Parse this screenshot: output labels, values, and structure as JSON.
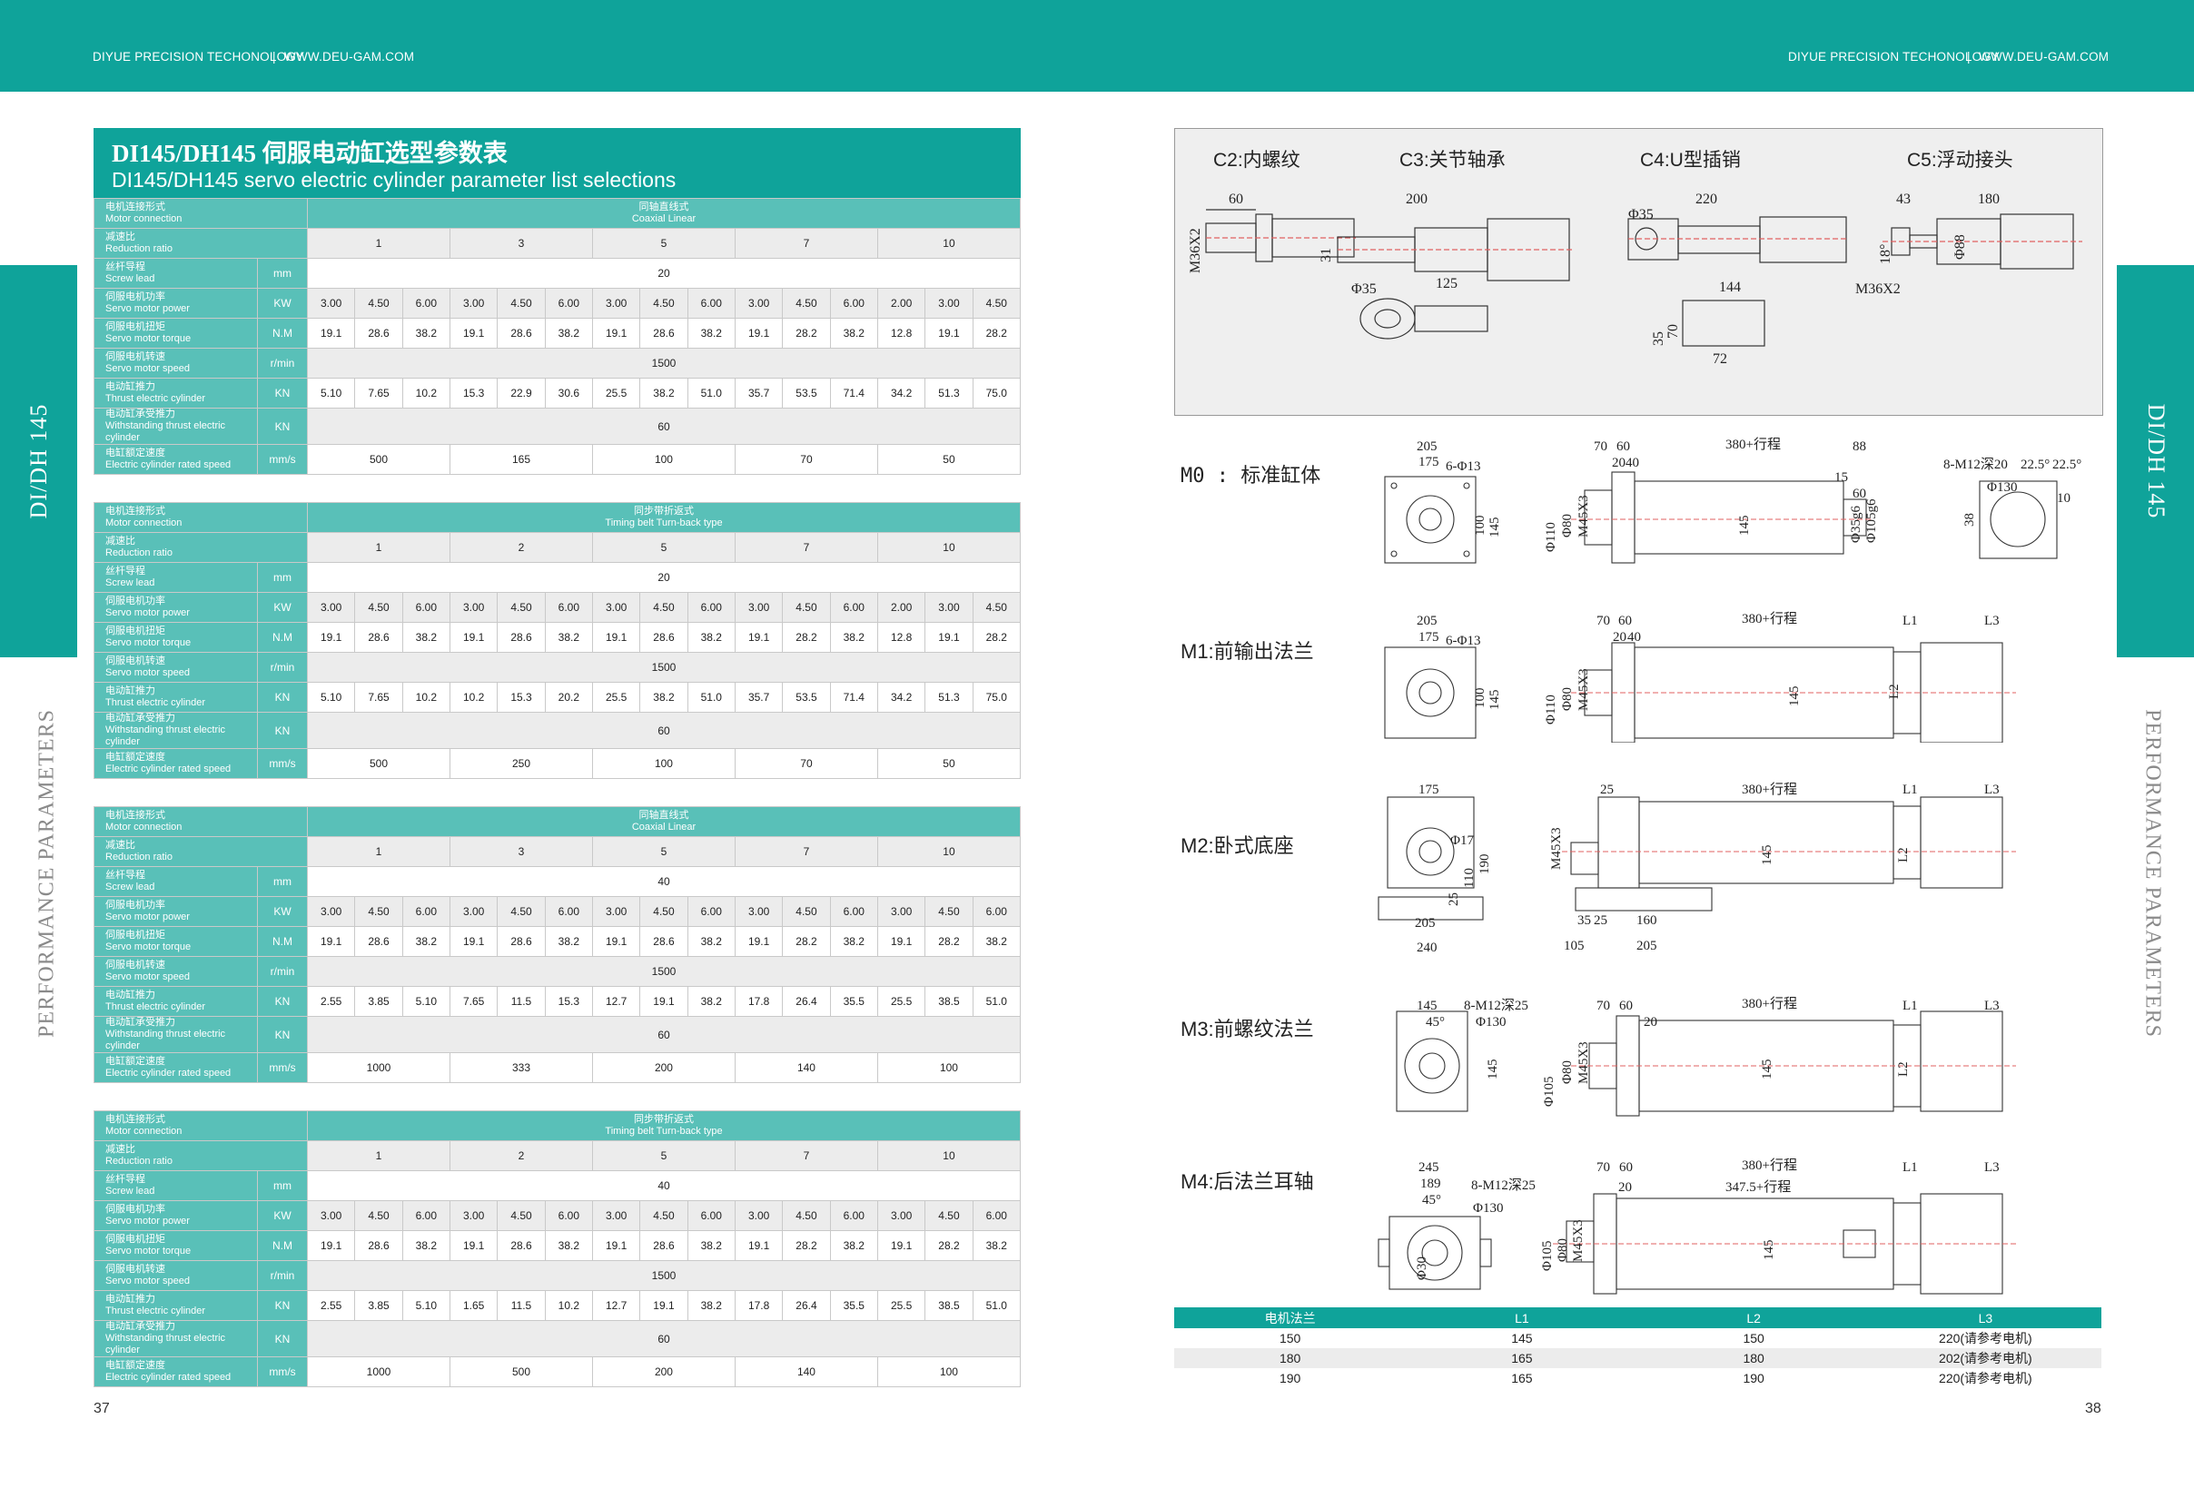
{
  "header": {
    "brand": "DIYUE PRECISION TECHONOLOGY",
    "sep": "|",
    "website": "WWW.DEU-GAM.COM"
  },
  "side": {
    "model": "DI/DH 145",
    "section": "PERFORMANCE PARAMETERS"
  },
  "title": {
    "cn": "DI145/DH145 伺服电动缸选型参数表",
    "en": "DI145/DH145 servo electric cylinder parameter list selections"
  },
  "labels": {
    "motor_cn": "电机连接形式",
    "motor_en": "Motor connection",
    "ratio_cn": "减速比",
    "ratio_en": "Reduction ratio",
    "lead_cn": "丝杆导程",
    "lead_en": "Screw lead",
    "power_cn": "伺服电机功率",
    "power_en": "Servo motor power",
    "torque_cn": "伺服电机扭矩",
    "torque_en": "Servo motor torque",
    "speed_cn": "伺服电机转速",
    "speed_en": "Servo motor speed",
    "thrust_cn": "电动缸推力",
    "thrust_en": "Thrust electric cylinder",
    "withstand_cn": "电动缸承受推力",
    "withstand_en": "Withstanding thrust electric cylinder",
    "rated_cn": "电缸额定速度",
    "rated_en": "Electric cylinder rated speed"
  },
  "units": {
    "lead": "mm",
    "power": "KW",
    "torque": "N.M",
    "speed": "r/min",
    "thrust": "KN",
    "withstand": "KN",
    "rated": "mm/s"
  },
  "tables": [
    {
      "type_cn": "同轴直线式",
      "type_en": "Coaxial Linear",
      "ratios": [
        "1",
        "3",
        "5",
        "7",
        "10"
      ],
      "lead": "20",
      "power": [
        "3.00",
        "4.50",
        "6.00",
        "3.00",
        "4.50",
        "6.00",
        "3.00",
        "4.50",
        "6.00",
        "3.00",
        "4.50",
        "6.00",
        "2.00",
        "3.00",
        "4.50"
      ],
      "torque": [
        "19.1",
        "28.6",
        "38.2",
        "19.1",
        "28.6",
        "38.2",
        "19.1",
        "28.6",
        "38.2",
        "19.1",
        "28.2",
        "38.2",
        "12.8",
        "19.1",
        "28.2"
      ],
      "speed": "1500",
      "thrust": [
        "5.10",
        "7.65",
        "10.2",
        "15.3",
        "22.9",
        "30.6",
        "25.5",
        "38.2",
        "51.0",
        "35.7",
        "53.5",
        "71.4",
        "34.2",
        "51.3",
        "75.0"
      ],
      "withstand": "60",
      "rated": [
        "500",
        "165",
        "100",
        "70",
        "50"
      ]
    },
    {
      "type_cn": "同步带折返式",
      "type_en": "Timing belt Turn-back type",
      "ratios": [
        "1",
        "2",
        "5",
        "7",
        "10"
      ],
      "lead": "20",
      "power": [
        "3.00",
        "4.50",
        "6.00",
        "3.00",
        "4.50",
        "6.00",
        "3.00",
        "4.50",
        "6.00",
        "3.00",
        "4.50",
        "6.00",
        "2.00",
        "3.00",
        "4.50"
      ],
      "torque": [
        "19.1",
        "28.6",
        "38.2",
        "19.1",
        "28.6",
        "38.2",
        "19.1",
        "28.6",
        "38.2",
        "19.1",
        "28.2",
        "38.2",
        "12.8",
        "19.1",
        "28.2"
      ],
      "speed": "1500",
      "thrust": [
        "5.10",
        "7.65",
        "10.2",
        "10.2",
        "15.3",
        "20.2",
        "25.5",
        "38.2",
        "51.0",
        "35.7",
        "53.5",
        "71.4",
        "34.2",
        "51.3",
        "75.0"
      ],
      "withstand": "60",
      "rated": [
        "500",
        "250",
        "100",
        "70",
        "50"
      ]
    },
    {
      "type_cn": "同轴直线式",
      "type_en": "Coaxial Linear",
      "ratios": [
        "1",
        "3",
        "5",
        "7",
        "10"
      ],
      "lead": "40",
      "power": [
        "3.00",
        "4.50",
        "6.00",
        "3.00",
        "4.50",
        "6.00",
        "3.00",
        "4.50",
        "6.00",
        "3.00",
        "4.50",
        "6.00",
        "3.00",
        "4.50",
        "6.00"
      ],
      "torque": [
        "19.1",
        "28.6",
        "38.2",
        "19.1",
        "28.6",
        "38.2",
        "19.1",
        "28.6",
        "38.2",
        "19.1",
        "28.2",
        "38.2",
        "19.1",
        "28.2",
        "38.2"
      ],
      "speed": "1500",
      "thrust": [
        "2.55",
        "3.85",
        "5.10",
        "7.65",
        "11.5",
        "15.3",
        "12.7",
        "19.1",
        "38.2",
        "17.8",
        "26.4",
        "35.5",
        "25.5",
        "38.5",
        "51.0"
      ],
      "withstand": "60",
      "rated": [
        "1000",
        "333",
        "200",
        "140",
        "100"
      ]
    },
    {
      "type_cn": "同步带折返式",
      "type_en": "Timing belt Turn-back type",
      "ratios": [
        "1",
        "2",
        "5",
        "7",
        "10"
      ],
      "lead": "40",
      "power": [
        "3.00",
        "4.50",
        "6.00",
        "3.00",
        "4.50",
        "6.00",
        "3.00",
        "4.50",
        "6.00",
        "3.00",
        "4.50",
        "6.00",
        "3.00",
        "4.50",
        "6.00"
      ],
      "torque": [
        "19.1",
        "28.6",
        "38.2",
        "19.1",
        "28.6",
        "38.2",
        "19.1",
        "28.6",
        "38.2",
        "19.1",
        "28.2",
        "38.2",
        "19.1",
        "28.2",
        "38.2"
      ],
      "speed": "1500",
      "thrust": [
        "2.55",
        "3.85",
        "5.10",
        "1.65",
        "11.5",
        "10.2",
        "12.7",
        "19.1",
        "38.2",
        "17.8",
        "26.4",
        "35.5",
        "25.5",
        "38.5",
        "51.0"
      ],
      "withstand": "60",
      "rated": [
        "1000",
        "500",
        "200",
        "140",
        "100"
      ]
    }
  ],
  "page_left": "37",
  "page_right": "38",
  "connectors": {
    "c2": "C2:内螺纹",
    "c3": "C3:关节轴承",
    "c4": "C4:U型插销",
    "c5": "C5:浮动接头"
  },
  "conn_dims": {
    "c2": [
      "60",
      "M36X2"
    ],
    "c3": [
      "200",
      "31",
      "125",
      "Φ35"
    ],
    "c4": [
      "220",
      "Φ35",
      "144",
      "70",
      "35",
      "72"
    ],
    "c5": [
      "43",
      "180",
      "18°",
      "Φ88",
      "M36X2"
    ]
  },
  "mounts": {
    "m0": "M0 : 标准缸体",
    "m1": "M1:前输出法兰",
    "m2": "M2:卧式底座",
    "m3": "M3:前螺纹法兰",
    "m4": "M4:后法兰耳轴"
  },
  "mount_dims": {
    "m0_front": [
      "205",
      "175",
      "6-Φ13",
      "100",
      "145"
    ],
    "m0_side": [
      "70",
      "60",
      "380+行程",
      "88",
      "20",
      "40",
      "15",
      "60",
      "Φ110",
      "Φ80",
      "M45X3",
      "145",
      "Φ35g6",
      "Φ105g6"
    ],
    "m0_end": [
      "8-M12深20",
      "22.5°",
      "22.5°",
      "Φ130",
      "10",
      "38"
    ],
    "m1_front": [
      "205",
      "175",
      "6-Φ13",
      "100",
      "145"
    ],
    "m1_side": [
      "70",
      "60",
      "380+行程",
      "L1",
      "L3",
      "20",
      "40",
      "Φ110",
      "Φ80",
      "M45X3",
      "145",
      "L2"
    ],
    "m2_front": [
      "175",
      "Φ17",
      "110",
      "190",
      "25",
      "205",
      "240"
    ],
    "m2_side": [
      "25",
      "380+行程",
      "L1",
      "L3",
      "M45X3",
      "145",
      "L2",
      "35",
      "25",
      "160",
      "105",
      "205"
    ],
    "m3_front": [
      "145",
      "8-M12深25",
      "45°",
      "Φ130",
      "145"
    ],
    "m3_side": [
      "70",
      "60",
      "380+行程",
      "L1",
      "L3",
      "20",
      "Φ105",
      "Φ80",
      "M45X3",
      "145",
      "L2"
    ],
    "m4_front": [
      "245",
      "189",
      "8-M12深25",
      "45°",
      "Φ130",
      "Φ30"
    ],
    "m4_side": [
      "70",
      "60",
      "380+行程",
      "L1",
      "L3",
      "20",
      "347.5+行程",
      "Φ105",
      "Φ80",
      "M45X3",
      "145"
    ]
  },
  "motor_table": {
    "headers": [
      "电机法兰",
      "L1",
      "L2",
      "L3"
    ],
    "rows": [
      [
        "150",
        "145",
        "150",
        "220(请参考电机)"
      ],
      [
        "180",
        "165",
        "180",
        "202(请参考电机)"
      ],
      [
        "190",
        "165",
        "190",
        "220(请参考电机)"
      ]
    ]
  }
}
